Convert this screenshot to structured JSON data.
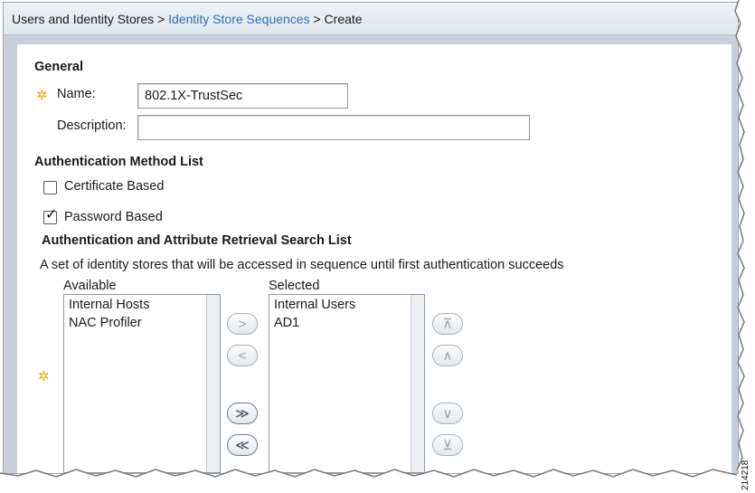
{
  "breadcrumb": {
    "item1": "Users and Identity Stores >",
    "item2": "Identity Store Sequences",
    "item3": "> Create"
  },
  "general": {
    "heading": "General",
    "name_label": "Name:",
    "name_value": "802.1X-TrustSec",
    "description_label": "Description:",
    "description_value": ""
  },
  "auth_method": {
    "heading": "Authentication Method List",
    "certificate_label": "Certificate Based",
    "certificate_checked": false,
    "password_label": "Password Based",
    "password_checked": true
  },
  "search_list": {
    "heading": "Authentication and Attribute Retrieval Search List",
    "description": "A set of identity stores that will be accessed in sequence until first authentication succeeds",
    "available_label": "Available",
    "available_items": [
      "Internal Hosts",
      "NAC Profiler"
    ],
    "selected_label": "Selected",
    "selected_items": [
      "Internal Users",
      "AD1"
    ]
  },
  "buttons": {
    "move_right": ">",
    "move_left": "<",
    "move_all_right": "≫",
    "move_all_left": "≪",
    "move_top": "⊼",
    "move_up": "∧",
    "move_down": "∨",
    "move_bottom": "⊻"
  },
  "figure_number": "214218"
}
